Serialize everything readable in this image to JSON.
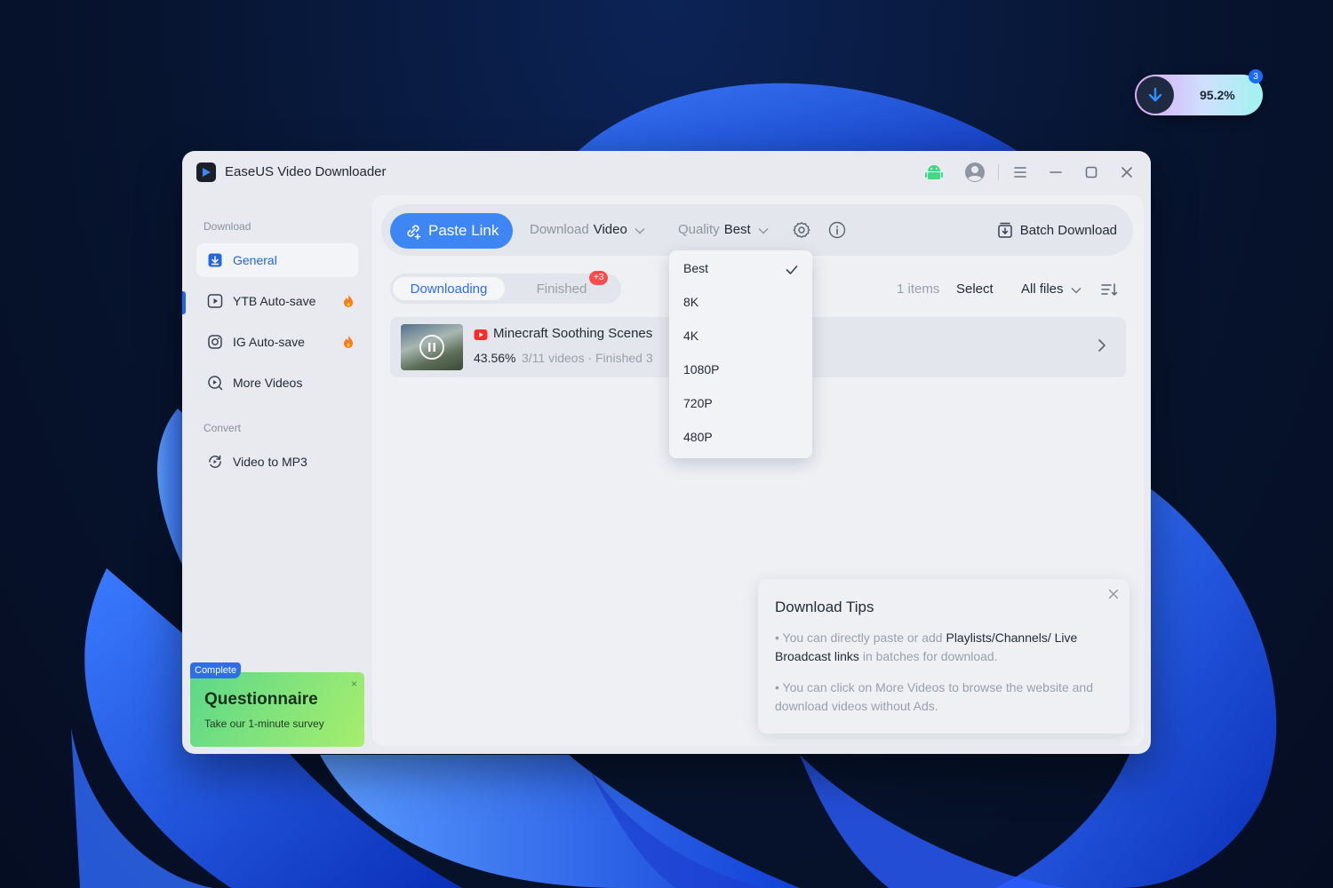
{
  "app": {
    "title": "EaseUS Video Downloader"
  },
  "float_widget": {
    "percent": "95.2%",
    "badge": "3"
  },
  "sidebar": {
    "download_section": "Download",
    "convert_section": "Convert",
    "items": [
      {
        "label": "General",
        "icon": "download-box-icon"
      },
      {
        "label": "YTB Auto-save",
        "icon": "play-box-icon"
      },
      {
        "label": "IG Auto-save",
        "icon": "instagram-icon"
      },
      {
        "label": "More Videos",
        "icon": "search-play-icon"
      }
    ],
    "convert_items": [
      {
        "label": "Video to MP3",
        "icon": "convert-icon"
      }
    ],
    "questionnaire": {
      "tag": "Complete",
      "title": "Questionnaire",
      "subtitle": "Take our 1-minute survey",
      "close": "×"
    }
  },
  "toolbar": {
    "paste_label": "Paste Link",
    "download_label": "Download",
    "download_value": "Video",
    "quality_label": "Quality",
    "quality_value": "Best",
    "batch_label": "Batch Download"
  },
  "tabs": {
    "downloading": "Downloading",
    "finished": "Finished",
    "finished_badge": "+3"
  },
  "list_controls": {
    "count": "1 items",
    "select": "Select",
    "filter": "All files"
  },
  "downloads": [
    {
      "title": "Minecraft Soothing Scenes",
      "progress": "43.56%",
      "meta": "3/11 videos · Finished 3",
      "source": "youtube",
      "progress_value": 43.56
    }
  ],
  "quality_menu": {
    "selected": "Best",
    "options": [
      "Best",
      "8K",
      "4K",
      "1080P",
      "720P",
      "480P"
    ]
  },
  "tips": {
    "title": "Download Tips",
    "tip1_a": "You can directly paste or add ",
    "tip1_b": "Playlists/Channels/ Live Broadcast links",
    "tip1_c": " in batches for download.",
    "tip2": "You can click on More Videos to browse the website and download videos without Ads."
  },
  "colors": {
    "accent": "#3f86f5",
    "active_text": "#2266e6",
    "badge_red": "#ff4d4f",
    "android_green": "#3ddc84"
  }
}
